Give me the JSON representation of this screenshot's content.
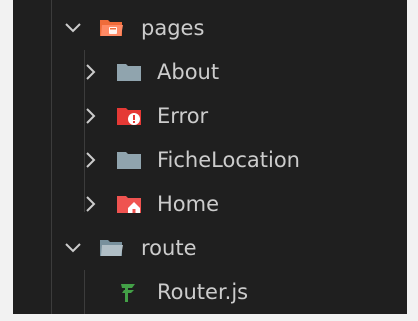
{
  "explorer": {
    "items": [
      {
        "label": "pages",
        "expanded": true,
        "icon": "folder-pages-open-icon"
      },
      {
        "label": "About",
        "expanded": false,
        "icon": "folder-icon"
      },
      {
        "label": "Error",
        "expanded": false,
        "icon": "folder-error-icon"
      },
      {
        "label": "FicheLocation",
        "expanded": false,
        "icon": "folder-icon"
      },
      {
        "label": "Home",
        "expanded": false,
        "icon": "folder-home-icon"
      },
      {
        "label": "route",
        "expanded": true,
        "icon": "folder-open-icon"
      },
      {
        "label": "Router.js",
        "icon": "router-file-icon"
      }
    ]
  },
  "colors": {
    "panel_bg": "#1f1f1f",
    "text": "#cccccc",
    "folder_gray": "#90a4ae",
    "folder_red": "#ef5350",
    "folder_orange": "#ff7043",
    "router_green": "#43a047"
  }
}
